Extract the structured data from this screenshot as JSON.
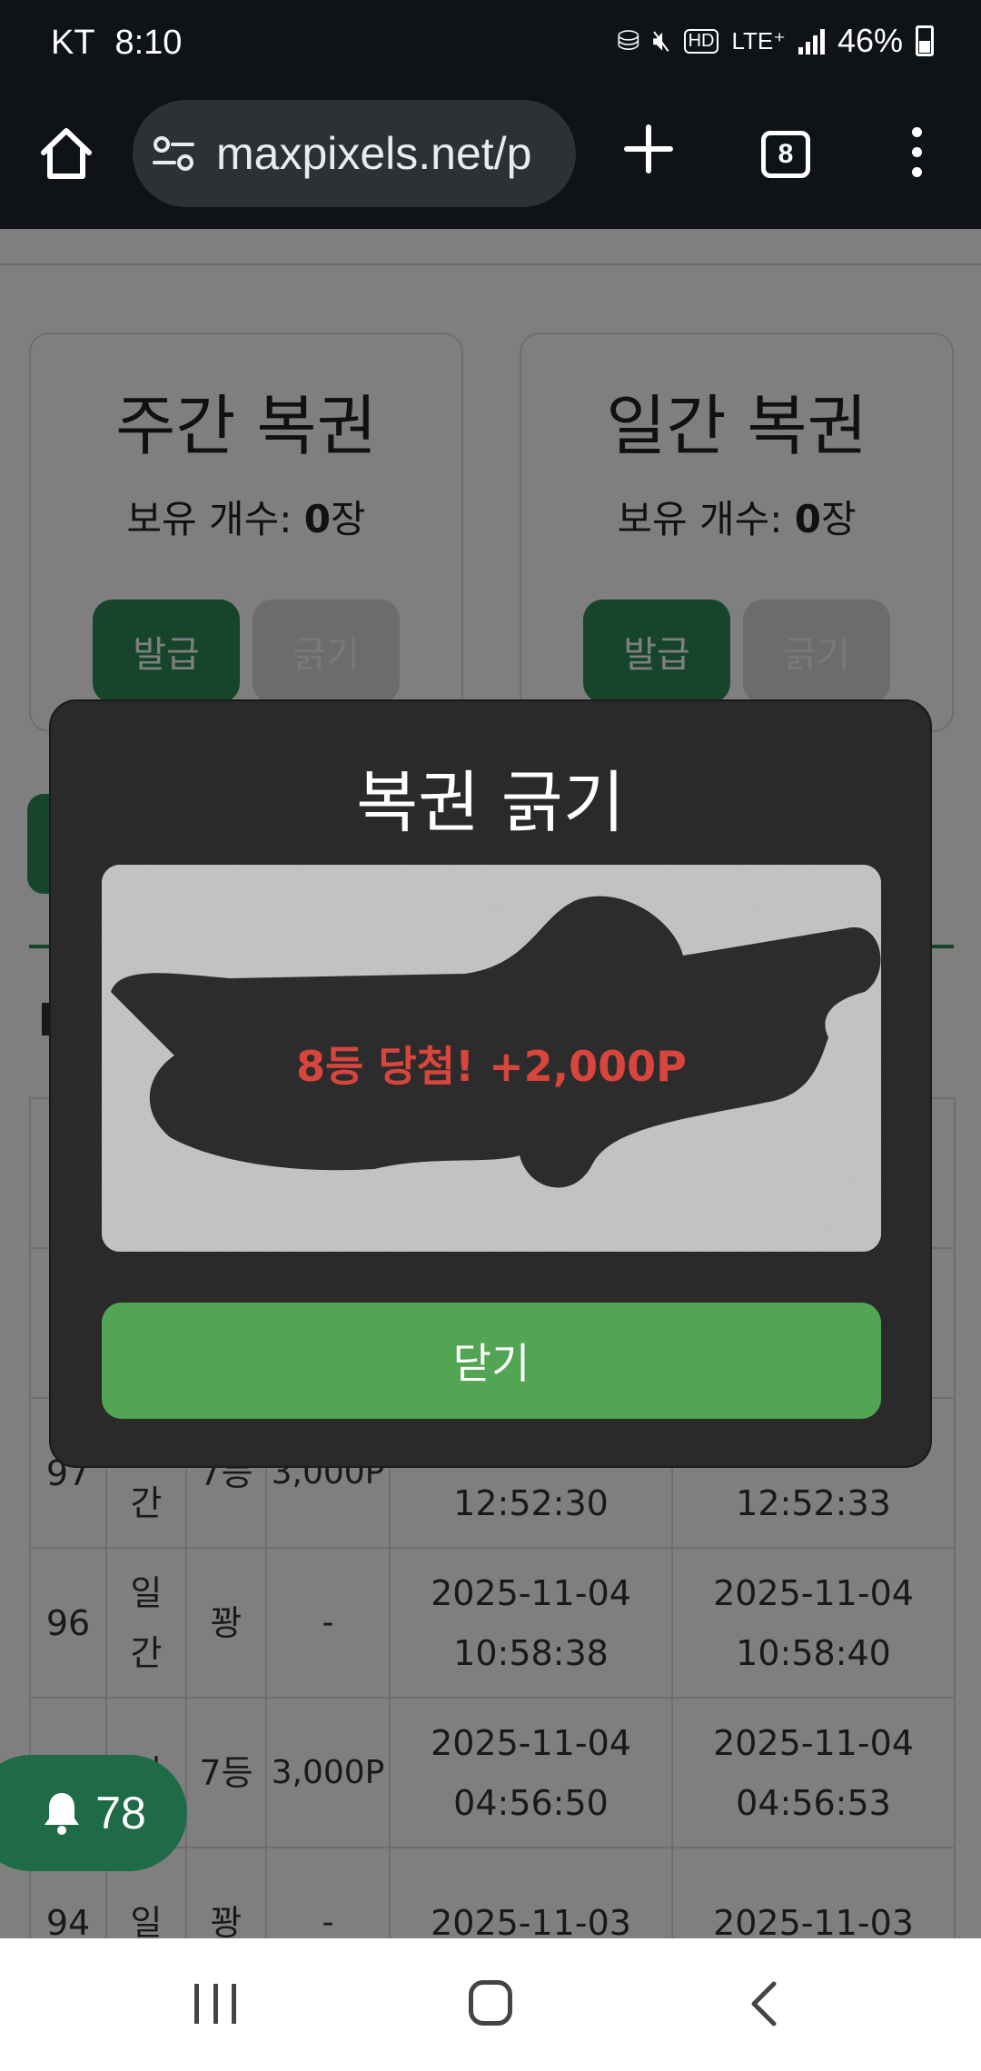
{
  "status_bar": {
    "carrier": "KT",
    "time": "8:10",
    "network": "LTE⁺",
    "hd": "HD",
    "battery": "46%"
  },
  "browser": {
    "url": "maxpixels.net/p",
    "tab_count": "8"
  },
  "cards": [
    {
      "title": "주간 복권",
      "count_label": "보유 개수: ",
      "count_value": "0",
      "count_unit": "장",
      "issue_label": "발급",
      "scratch_label": "긁기"
    },
    {
      "title": "일간 복권",
      "count_label": "보유 개수: ",
      "count_value": "0",
      "count_unit": "장",
      "issue_label": "발급",
      "scratch_label": "긁기"
    }
  ],
  "table": {
    "rows": [
      {
        "id": "",
        "type1": "",
        "type2": "",
        "rank": "",
        "prize": "",
        "date1": "",
        "time1": "",
        "date2": "",
        "time2": ""
      },
      {
        "id": "",
        "type1": "",
        "type2": "",
        "rank": "",
        "prize": "",
        "date1": "",
        "time1": "",
        "date2": "",
        "time2": ""
      },
      {
        "id": "97",
        "type1": "",
        "type2": "간",
        "rank": "7등",
        "prize": "3,000P",
        "date1": "",
        "time1": "12:52:30",
        "date2": "",
        "time2": "12:52:33"
      },
      {
        "id": "96",
        "type1": "일",
        "type2": "간",
        "rank": "꽝",
        "prize": "-",
        "date1": "2025-11-04",
        "time1": "10:58:38",
        "date2": "2025-11-04",
        "time2": "10:58:40"
      },
      {
        "id": "",
        "type1": "일",
        "type2": "",
        "rank": "7등",
        "prize": "3,000P",
        "date1": "2025-11-04",
        "time1": "04:56:50",
        "date2": "2025-11-04",
        "time2": "04:56:53"
      },
      {
        "id": "94",
        "type1": "일",
        "type2": "",
        "rank": "꽝",
        "prize": "-",
        "date1": "2025-11-03",
        "time1": "",
        "date2": "2025-11-03",
        "time2": ""
      }
    ]
  },
  "notification": {
    "count": "78",
    "icon": "bell-icon"
  },
  "modal": {
    "title": "복권 긁기",
    "prize_text": "8등 당첨! +2,000P",
    "close_label": "닫기"
  },
  "colors": {
    "brand_green": "#2d8a57",
    "close_button": "#52a552",
    "prize_red": "#d8453d",
    "modal_bg": "#2a2a2a"
  }
}
